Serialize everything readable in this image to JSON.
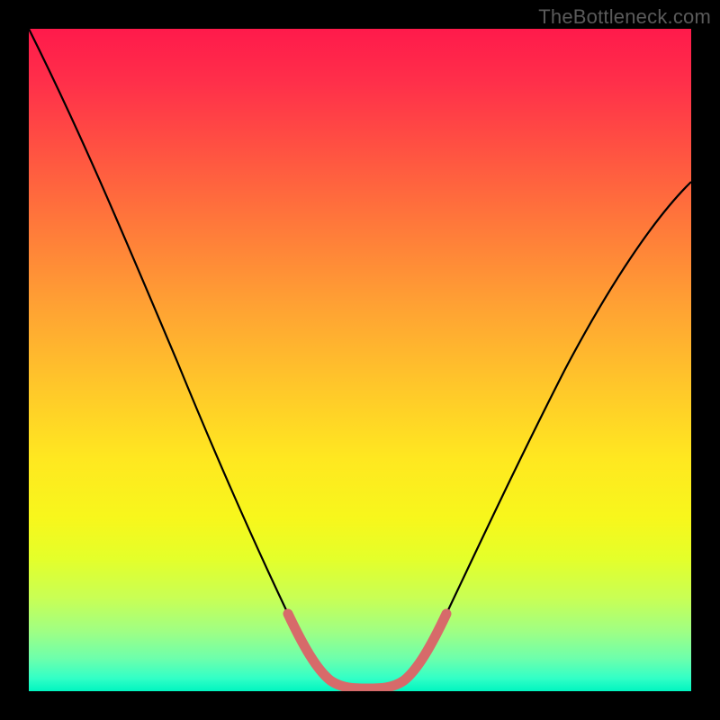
{
  "watermark": "TheBottleneck.com",
  "colors": {
    "frame": "#000000",
    "curve": "#000000",
    "highlight": "#d76a6a"
  },
  "chart_data": {
    "type": "line",
    "title": "",
    "xlabel": "",
    "ylabel": "",
    "xlim": [
      0,
      100
    ],
    "ylim": [
      0,
      100
    ],
    "grid": false,
    "legend": false,
    "series": [
      {
        "name": "bottleneck-curve",
        "x": [
          0,
          5,
          10,
          15,
          20,
          25,
          30,
          35,
          40,
          43,
          46,
          50,
          54,
          57,
          60,
          65,
          70,
          75,
          80,
          85,
          90,
          95,
          100
        ],
        "y": [
          100,
          90,
          80,
          70,
          60,
          50,
          40,
          30,
          18,
          9,
          3,
          0.5,
          0.5,
          3,
          9,
          18,
          27,
          35,
          43,
          50,
          57,
          63,
          68
        ]
      }
    ],
    "highlight_segment": {
      "name": "optimal-range",
      "x": [
        40,
        43,
        46,
        50,
        54,
        57,
        60
      ],
      "y": [
        18,
        9,
        3,
        0.5,
        0.5,
        3,
        9
      ]
    },
    "gradient_stops": [
      {
        "pos": 0.0,
        "color": "#ff1a4b"
      },
      {
        "pos": 0.18,
        "color": "#ff5142"
      },
      {
        "pos": 0.42,
        "color": "#ffa233"
      },
      {
        "pos": 0.65,
        "color": "#ffe820"
      },
      {
        "pos": 0.86,
        "color": "#c8ff55"
      },
      {
        "pos": 1.0,
        "color": "#00f5c0"
      }
    ]
  }
}
